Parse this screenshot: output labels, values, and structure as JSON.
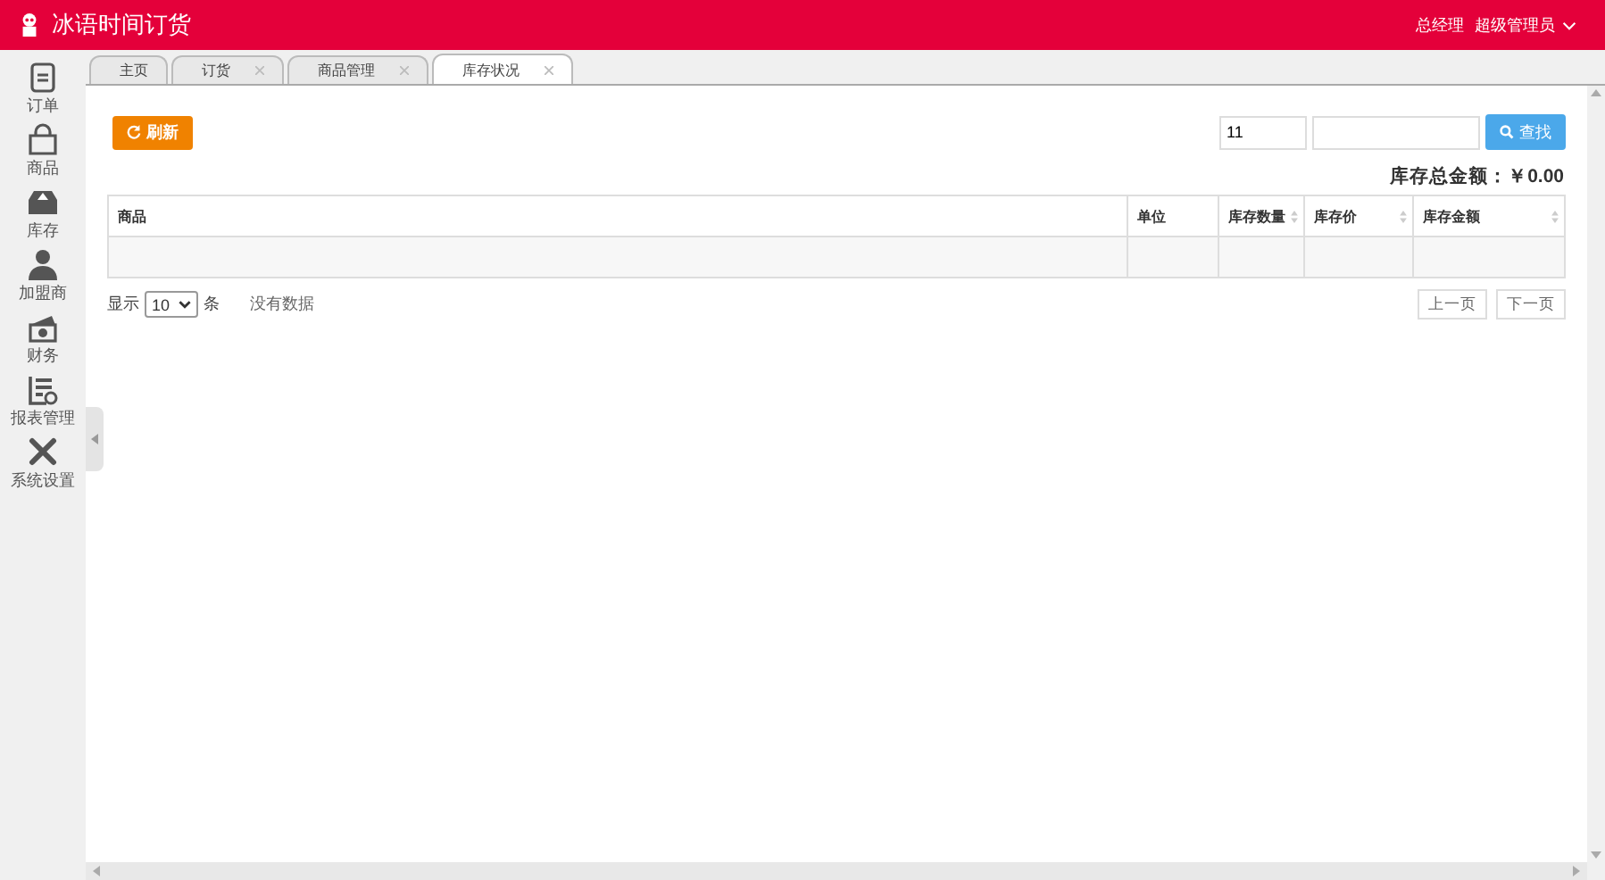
{
  "header": {
    "title": "冰语时间订货",
    "role": "总经理",
    "user": "超级管理员"
  },
  "sidebar": {
    "items": [
      {
        "label": "订单",
        "kind": "doc"
      },
      {
        "label": "商品",
        "kind": "bag"
      },
      {
        "label": "库存",
        "kind": "box"
      },
      {
        "label": "加盟商",
        "kind": "person"
      },
      {
        "label": "财务",
        "kind": "money"
      },
      {
        "label": "报表管理",
        "kind": "report"
      },
      {
        "label": "系统设置",
        "kind": "tools"
      }
    ]
  },
  "tabs": [
    {
      "label": "主页",
      "closable": false,
      "selected": false
    },
    {
      "label": "订货",
      "closable": true,
      "selected": false
    },
    {
      "label": "商品管理",
      "closable": true,
      "selected": false
    },
    {
      "label": "库存状况",
      "closable": true,
      "selected": true
    }
  ],
  "toolbar": {
    "refresh": "刷新",
    "code_value": "11",
    "search": "查找"
  },
  "total": "库存总金额：￥0.00",
  "table": {
    "columns": [
      {
        "label": "商品",
        "sortable": false
      },
      {
        "label": "单位",
        "sortable": false
      },
      {
        "label": "库存数量",
        "sortable": true
      },
      {
        "label": "库存价",
        "sortable": true
      },
      {
        "label": "库存金额",
        "sortable": true
      }
    ]
  },
  "footer": {
    "show": "显示",
    "page_size": "10",
    "unit": "条",
    "info": "没有数据",
    "prev": "上一页",
    "next": "下一页"
  }
}
